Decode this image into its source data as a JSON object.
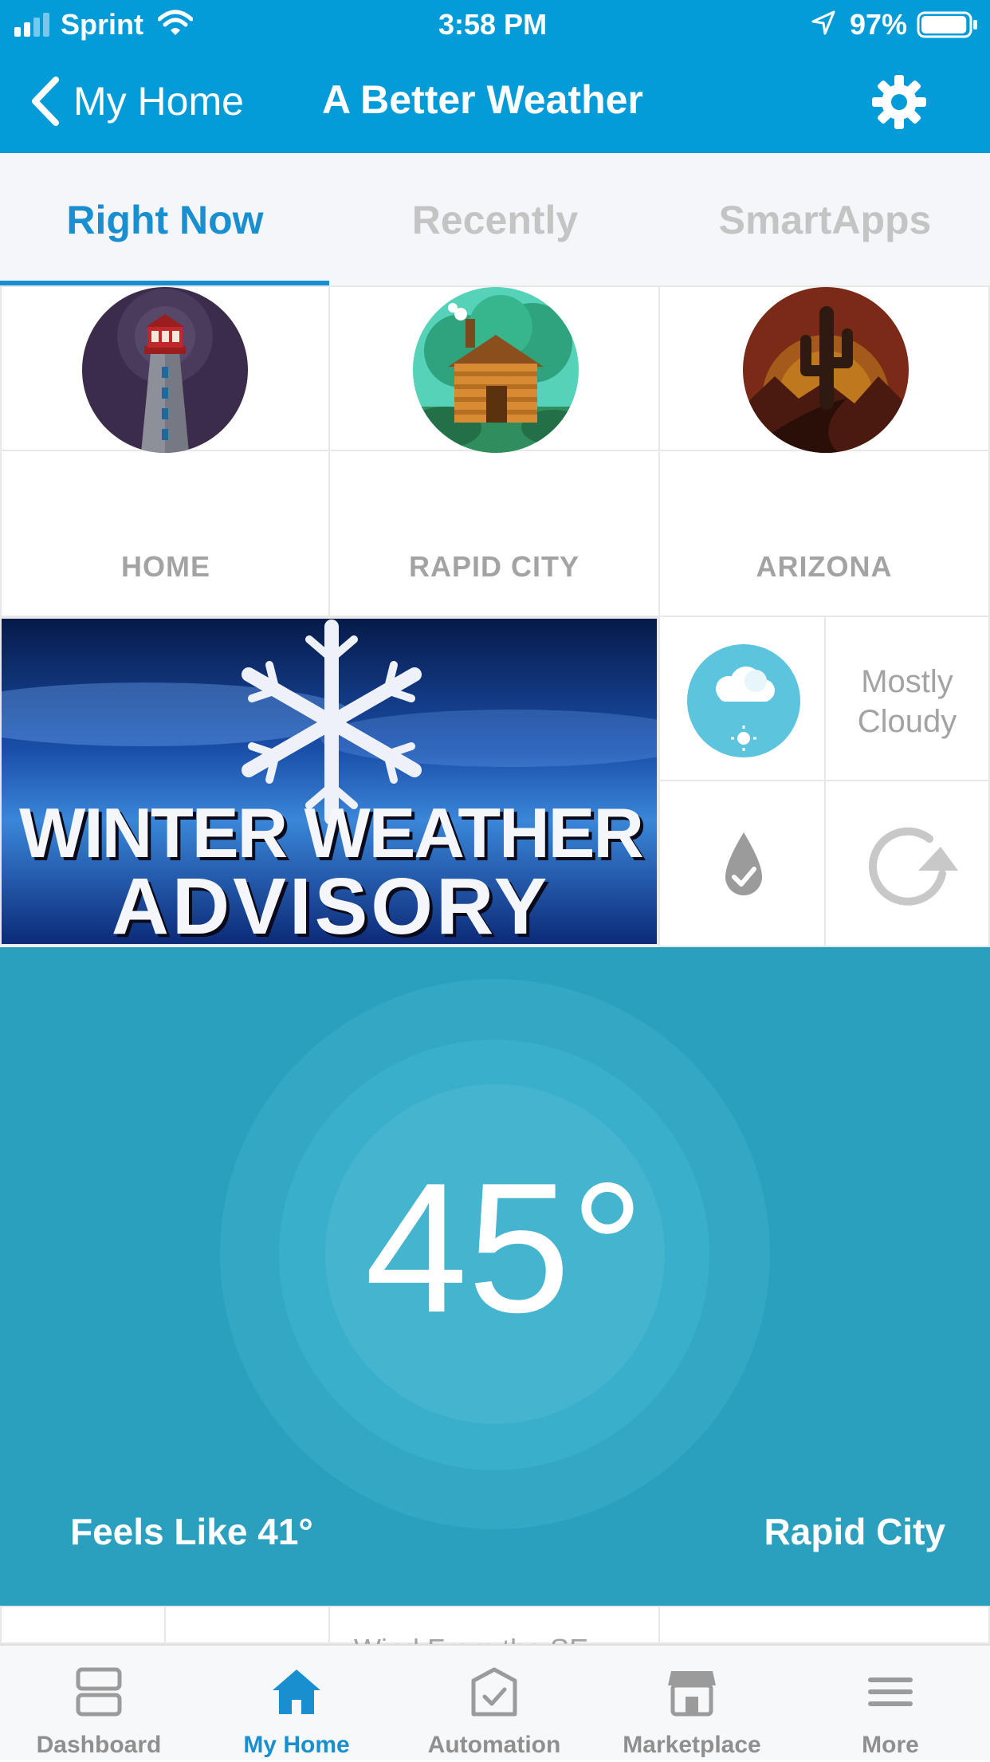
{
  "status_bar": {
    "carrier": "Sprint",
    "time": "3:58 PM",
    "battery": "97%",
    "battery_level": 0.97
  },
  "nav": {
    "back_label": "My Home",
    "title": "A Better Weather"
  },
  "tabs": [
    {
      "label": "Right Now",
      "active": true
    },
    {
      "label": "Recently",
      "active": false
    },
    {
      "label": "SmartApps",
      "active": false
    }
  ],
  "locations": [
    {
      "label": "HOME",
      "image": "lighthouse-image"
    },
    {
      "label": "RAPID CITY",
      "image": "log-cabin-image"
    },
    {
      "label": "ARIZONA",
      "image": "desert-cactus-image"
    }
  ],
  "advisory": {
    "line1": "WINTER WEATHER",
    "line2": "ADVISORY"
  },
  "conditions": {
    "summary": "Mostly Cloudy",
    "icon": "partly-cloudy-icon"
  },
  "main": {
    "temperature": "45°",
    "feels_like": "Feels Like 41°",
    "location": "Rapid City"
  },
  "below_partial": {
    "wind_text": "Wind From the SE"
  },
  "tabbar": [
    {
      "label": "Dashboard",
      "icon": "dashboard-icon",
      "active": false
    },
    {
      "label": "My Home",
      "icon": "home-icon",
      "active": true
    },
    {
      "label": "Automation",
      "icon": "automation-icon",
      "active": false
    },
    {
      "label": "Marketplace",
      "icon": "marketplace-icon",
      "active": false
    },
    {
      "label": "More",
      "icon": "menu-icon",
      "active": false
    }
  ],
  "colors": {
    "brand_blue": "#049cd8",
    "active_tab": "#1a8fd0",
    "temp_panel": "#2b9fbe"
  }
}
